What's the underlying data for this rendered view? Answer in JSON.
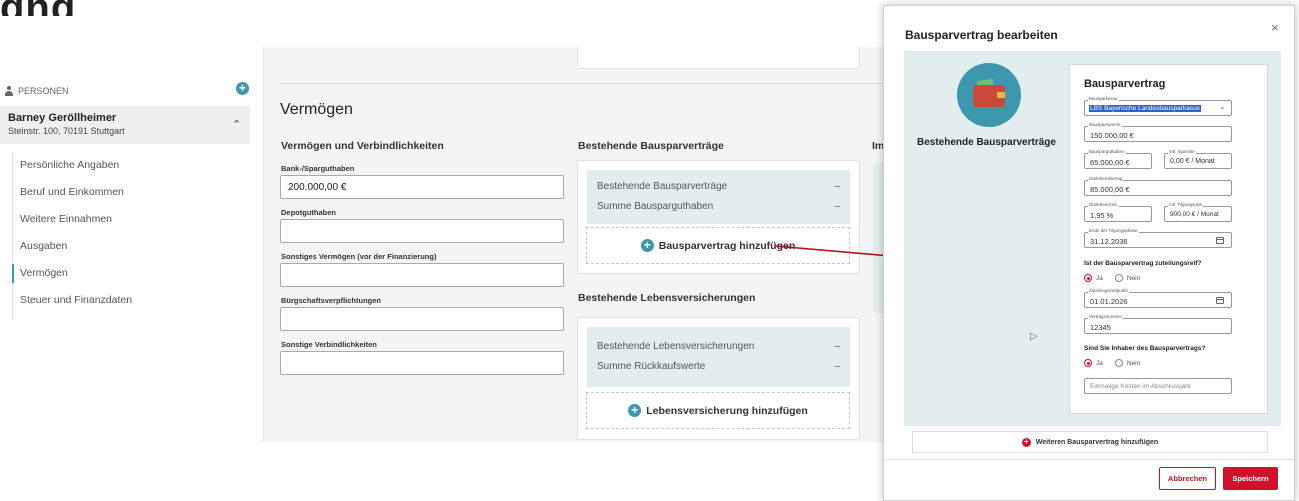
{
  "page_heading_fragment": "gng",
  "sidebar": {
    "header": "PERSONEN",
    "add_icon": "plus-circle-icon",
    "person": {
      "name": "Barney Geröllheimer",
      "address": "Steinstr. 100, 70191 Stuttgart"
    },
    "items": [
      {
        "label": "Persönliche Angaben",
        "active": false
      },
      {
        "label": "Beruf und Einkommen",
        "active": false
      },
      {
        "label": "Weitere Einnahmen",
        "active": false
      },
      {
        "label": "Ausgaben",
        "active": false
      },
      {
        "label": "Vermögen",
        "active": true
      },
      {
        "label": "Steuer und Finanzdaten",
        "active": false
      }
    ]
  },
  "main": {
    "section_title": "Vermögen",
    "col1": {
      "title": "Vermögen und Verbindlichkeiten",
      "fields": [
        {
          "label": "Bank-/Sparguthaben",
          "value": "200.000,00 €"
        },
        {
          "label": "Depotguthaben",
          "value": ""
        },
        {
          "label": "Sonstiges Vermögen (vor der Finanzierung)",
          "value": ""
        },
        {
          "label": "Bürgschaftsverpflichtungen",
          "value": ""
        },
        {
          "label": "Sonstige Verbindlichkeiten",
          "value": ""
        }
      ]
    },
    "col2": {
      "bauspar": {
        "title": "Bestehende Bausparverträge",
        "rows": [
          {
            "label": "Bestehende Bausparverträge",
            "value": "–"
          },
          {
            "label": "Summe Bausparguthaben",
            "value": "–"
          }
        ],
        "add_label": "Bausparvertrag hinzufügen"
      },
      "leben": {
        "title": "Bestehende Lebensversicherungen",
        "rows": [
          {
            "label": "Bestehende Lebensversicherungen",
            "value": "–"
          },
          {
            "label": "Summe Rückkaufswerte",
            "value": "–"
          }
        ],
        "add_label": "Lebensversicherung hinzufügen"
      }
    },
    "col3_fragment": "Im"
  },
  "modal": {
    "title": "Bausparvertrag bearbeiten",
    "close": "×",
    "left_label": "Bestehende Bausparverträge",
    "form": {
      "title": "Bausparvertrag",
      "bausparkasse": {
        "label": "Bausparkasse",
        "value": "LBS Bayerische Landesbausparkasse"
      },
      "bausparsumme": {
        "label": "Bausparsumme",
        "value": "150.000,00 €"
      },
      "bausparguthaben": {
        "label": "Bausparguthaben",
        "value": "65.000,00 €"
      },
      "sparrate": {
        "label": "mtl. Sparrate",
        "value": "0,00 € / Monat"
      },
      "darlehensbetrag": {
        "label": "Darlehensbetrag",
        "value": "85.000,00 €"
      },
      "darlehenszins": {
        "label": "Darlehenszins",
        "value": "1,95 %"
      },
      "tilgungsrate": {
        "label": "mtl. Tilgungsrate",
        "value": "900,00 € / Monat"
      },
      "ende_tilgung": {
        "label": "Ende der Tilgungsphase",
        "value": "31.12.2036"
      },
      "q_zuteilungsreif": "Ist der Bausparvertrag zuteilungsreif?",
      "ja": "Ja",
      "nein": "Nein",
      "zuteilungszeitpunkt": {
        "label": "Zuteilungszeitpunkt",
        "value": "01.01.2026"
      },
      "vertragsnummer": {
        "label": "Vertragsnummer",
        "value": "12345"
      },
      "q_inhaber": "Sind Sie Inhaber des Bausparvertrags?",
      "kosten_placeholder": "Einmalige Kosten im Abschlussjahr"
    },
    "weitere_label": "Weiteren Bausparvertrag hinzufügen",
    "cancel_label": "Abbrechen",
    "save_label": "Speichern"
  },
  "colors": {
    "accent": "#3d98ad",
    "panel_bg": "#e2eeee",
    "danger": "#d0112b",
    "arrow": "#b3121c"
  }
}
